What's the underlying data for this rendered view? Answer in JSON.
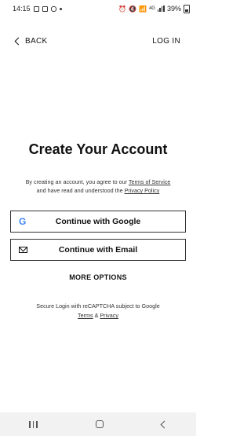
{
  "status_bar": {
    "time": "14:15",
    "network": "4G",
    "battery": "39%"
  },
  "top_nav": {
    "back_label": "BACK",
    "login_label": "LOG IN"
  },
  "main": {
    "title": "Create Your Account",
    "terms_prefix": "By creating an account, you agree to our ",
    "terms_link": "Terms of Service",
    "terms_mid": "and have read and understood the ",
    "privacy_link": "Privacy Policy",
    "google_button": "Continue with Google",
    "google_icon_glyph": "G",
    "email_button": "Continue with Email",
    "more_options": "MORE OPTIONS",
    "recaptcha_text": "Secure Login with reCAPTCHA subject to Google",
    "recaptcha_terms": "Terms",
    "recaptcha_amp": " & ",
    "recaptcha_privacy": "Privacy"
  },
  "colors": {
    "google_blue": "#4285F4",
    "text": "#111111",
    "nav_bar_bg": "#f2f2f2"
  }
}
